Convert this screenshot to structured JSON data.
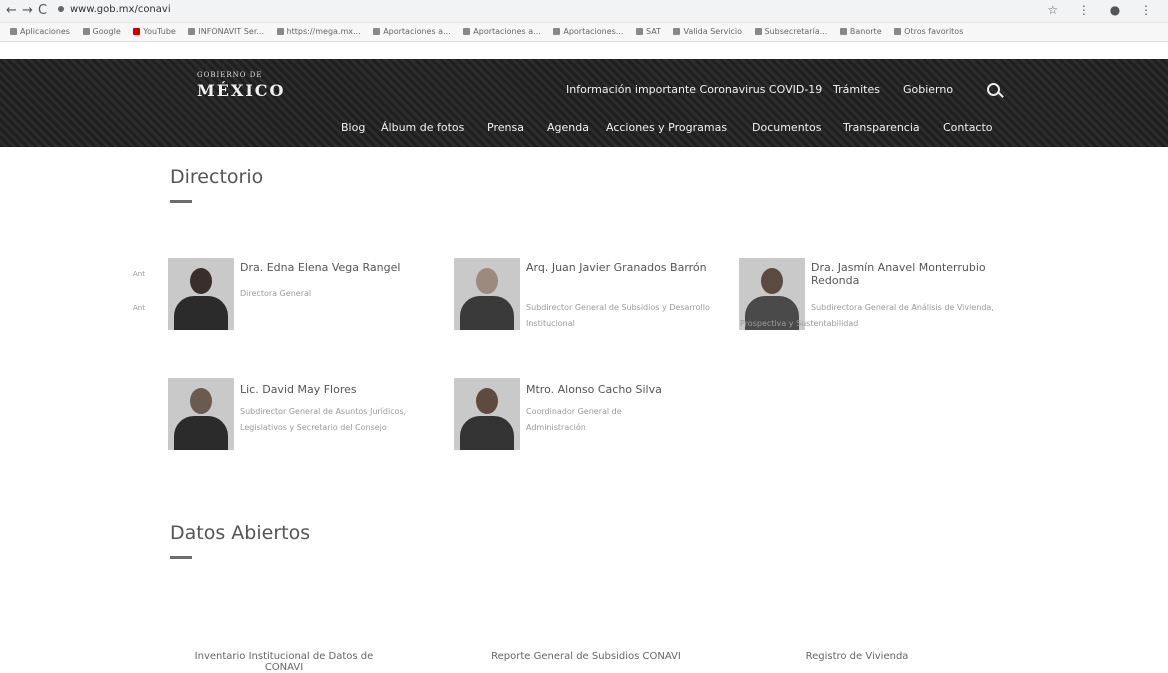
{
  "browser": {
    "back": "←",
    "forward": "→",
    "reload": "C",
    "url": "www.gob.mx/conavi",
    "right_icons": "☆ ⋮ ● ⋮",
    "bookmarks": [
      "Aplicaciones",
      "Google",
      "YouTube",
      "INFONAVIT Ser...",
      "https://mega.mx...",
      "Aportaciones a...",
      "Aportaciones a...",
      "Aportaciones...",
      "SAT",
      "Valida Servicio",
      "Subsecretaría...",
      "Banorte",
      "Otros favoritos"
    ]
  },
  "header": {
    "logo_small": "GOBIERNO DE",
    "logo_big": "MÉXICO",
    "top_links": [
      "Información importante Coronavirus COVID-19",
      "Trámites",
      "Gobierno"
    ],
    "sub_links": [
      "Blog",
      "Álbum de fotos",
      "Prensa",
      "Agenda",
      "Acciones y Programas",
      "Documentos",
      "Transparencia",
      "Contacto"
    ]
  },
  "directory": {
    "title": "Directorio",
    "side_labels": [
      "Ant",
      "Ant"
    ],
    "people": [
      {
        "name": "Dra. Edna Elena Vega Rangel",
        "role": "Directora General"
      },
      {
        "name": "Arq. Juan Javier Granados Barrón",
        "role": "Subdirector General de Subsidios y Desarrollo Institucional"
      },
      {
        "name": "Dra. Jasmín Anavel Monterrubio Redonda",
        "role": "Subdirectora General de Análisis de Vivienda, Prospectiva y Sustentabilidad"
      },
      {
        "name": "Lic. David May Flores",
        "role": "Subdirector General de Asuntos Jurídicos, Legislativos y Secretario del Consejo"
      },
      {
        "name": "Mtro. Alonso Cacho Silva",
        "role": "Coordinador General de Administración"
      }
    ]
  },
  "open_data": {
    "title": "Datos Abiertos",
    "datasets": [
      "Inventario Institucional de Datos de CONAVI",
      "Reporte General de Subsidios CONAVI",
      "Registro de Vivienda"
    ]
  }
}
